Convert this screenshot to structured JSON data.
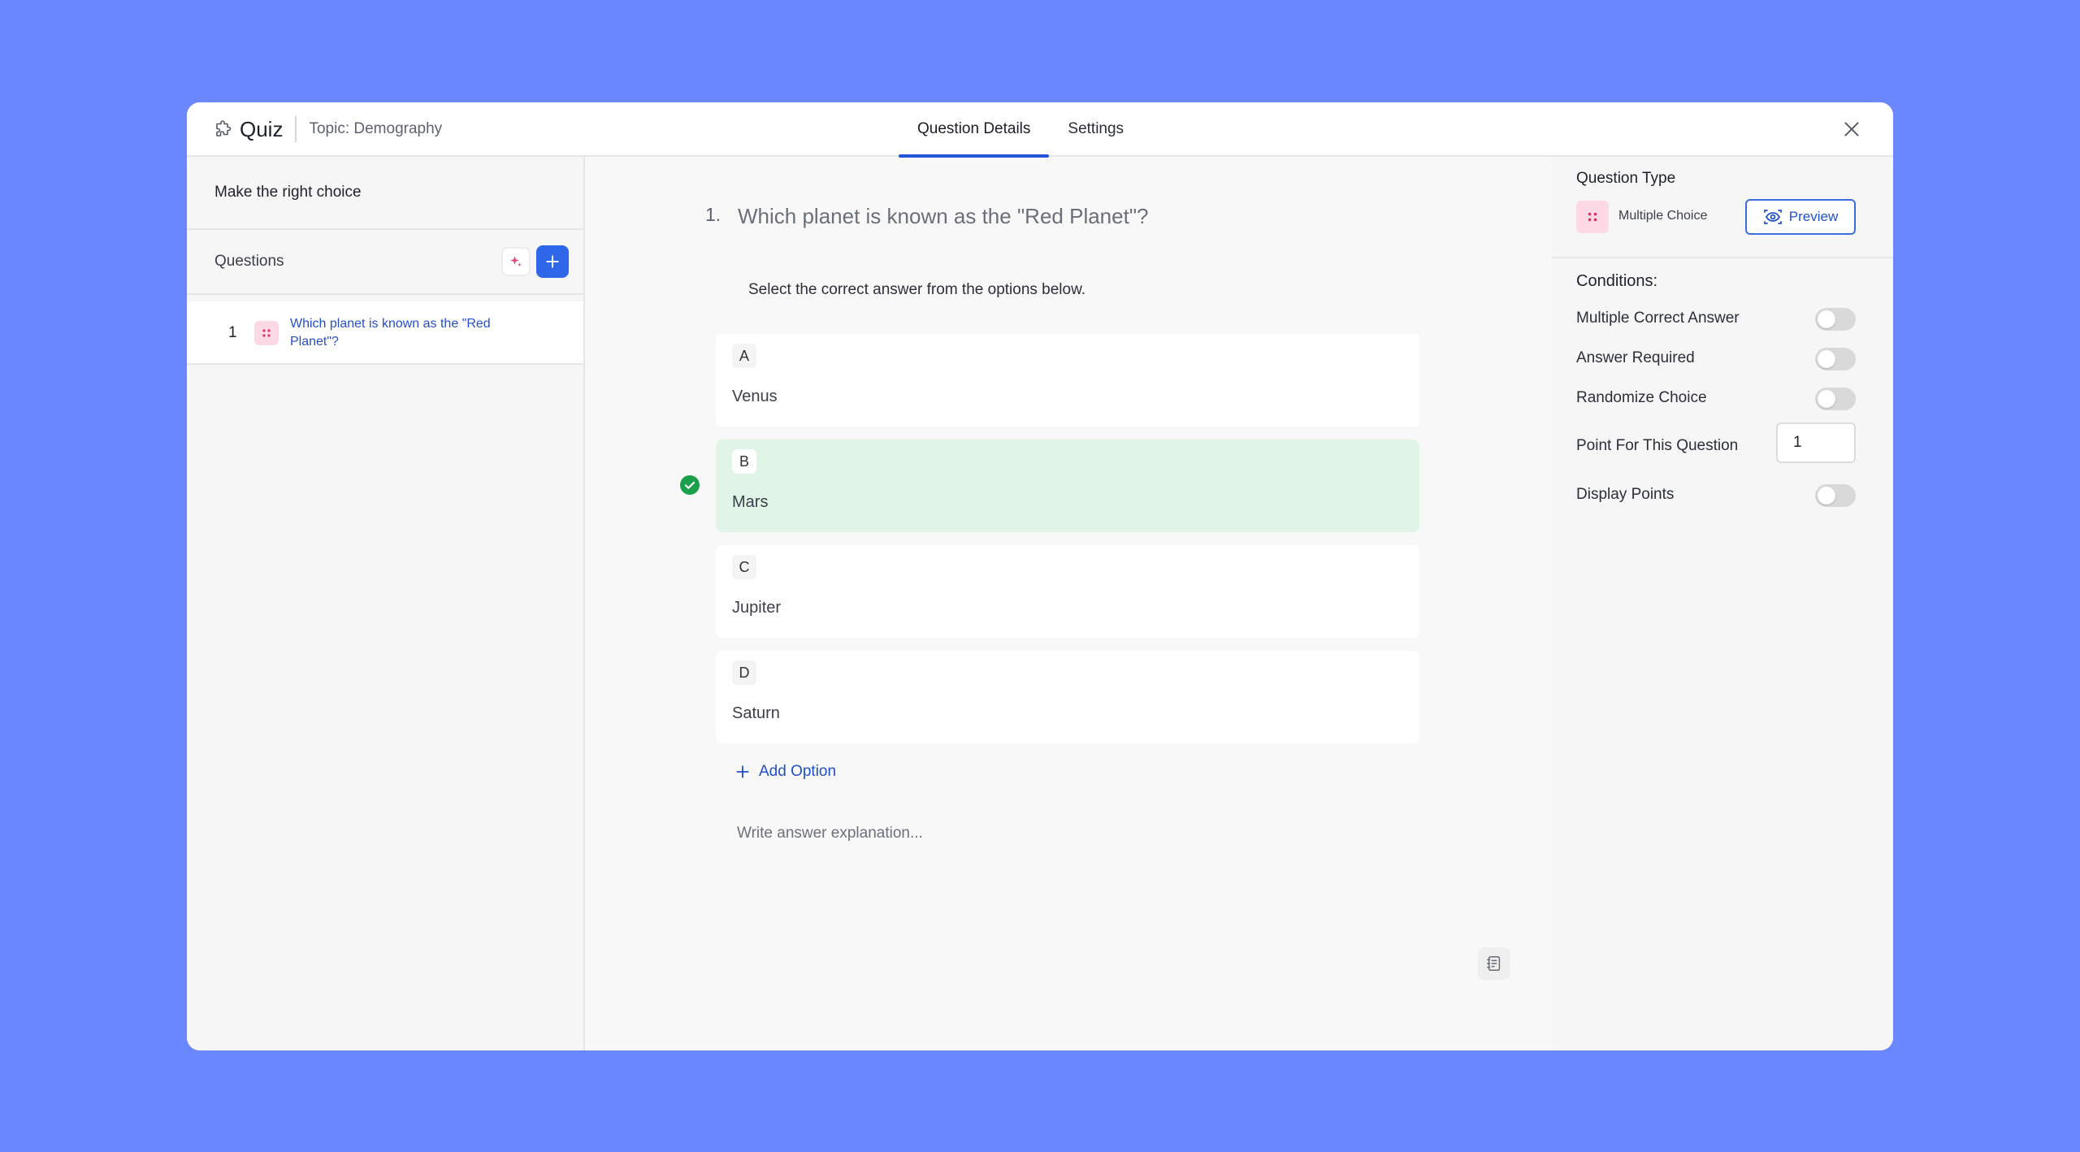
{
  "header": {
    "app_title": "Quiz",
    "topic": "Topic: Demography",
    "tabs": [
      {
        "label": "Question Details",
        "active": true
      },
      {
        "label": "Settings",
        "active": false
      }
    ],
    "icons": {
      "brand": "puzzle-icon",
      "close": "close-icon"
    }
  },
  "sidebar": {
    "quiz_name": "Make the right choice",
    "questions_label": "Questions",
    "items": [
      {
        "number": "1",
        "text": "Which planet is known as the \"Red Planet\"?",
        "type_icon": "multiple-choice-icon"
      }
    ]
  },
  "question": {
    "number": "1.",
    "title": "Which planet is known as the \"Red Planet\"?",
    "instructions": "Select the correct answer from the options below.",
    "options": [
      {
        "letter": "A",
        "text": "Venus",
        "correct": false
      },
      {
        "letter": "B",
        "text": "Mars",
        "correct": true
      },
      {
        "letter": "C",
        "text": "Jupiter",
        "correct": false
      },
      {
        "letter": "D",
        "text": "Saturn",
        "correct": false
      }
    ],
    "add_option_label": "Add Option",
    "explanation_placeholder": "Write answer explanation..."
  },
  "settings_panel": {
    "question_type_label": "Question Type",
    "question_type_value": "Multiple Choice",
    "preview_label": "Preview",
    "conditions_title": "Conditions:",
    "conditions": [
      {
        "label": "Multiple Correct Answer",
        "enabled": false
      },
      {
        "label": "Answer Required",
        "enabled": false
      },
      {
        "label": "Randomize Choice",
        "enabled": false
      }
    ],
    "points_label": "Point For This Question",
    "points_value": "1",
    "display_points_label": "Display Points",
    "display_points_enabled": false
  },
  "colors": {
    "background": "#6b87fe",
    "accent": "#2e67ea",
    "correct_bg": "#e0f4e8",
    "correct_check": "#1aa04a",
    "type_badge": "#fdd9e6"
  }
}
